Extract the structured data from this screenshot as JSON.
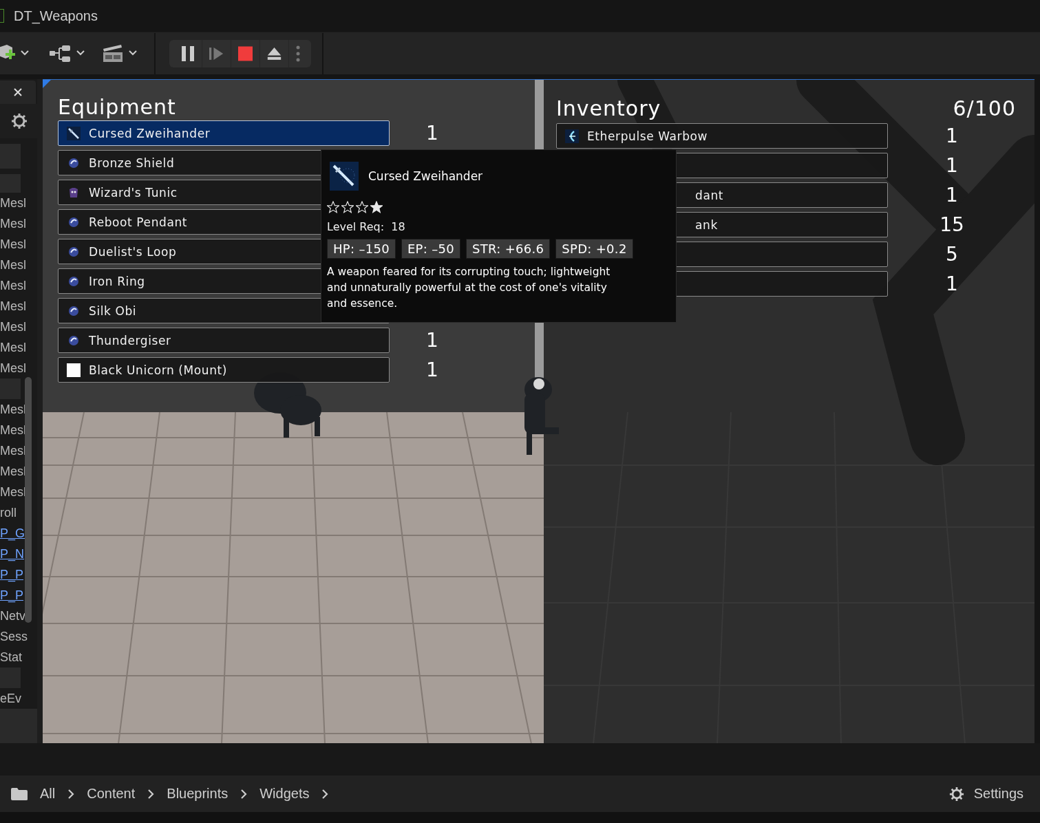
{
  "window": {
    "title": "DT_Weapons"
  },
  "sidebar": {
    "items": [
      {
        "kind": "text",
        "label": "Mesl"
      },
      {
        "kind": "text",
        "label": "Mesl"
      },
      {
        "kind": "text",
        "label": "Mesl"
      },
      {
        "kind": "text",
        "label": "Mesl"
      },
      {
        "kind": "text",
        "label": "Mesl"
      },
      {
        "kind": "text",
        "label": "Mesl"
      },
      {
        "kind": "text",
        "label": "Mesl"
      },
      {
        "kind": "text",
        "label": "Mesl"
      },
      {
        "kind": "text",
        "label": "Mesl"
      },
      {
        "kind": "spacer"
      },
      {
        "kind": "text",
        "label": "Mesl"
      },
      {
        "kind": "text",
        "label": "Mesl"
      },
      {
        "kind": "text",
        "label": "Mesl"
      },
      {
        "kind": "text",
        "label": "Mesl"
      },
      {
        "kind": "text",
        "label": "Mesl"
      },
      {
        "kind": "text",
        "label": "roll"
      },
      {
        "kind": "link",
        "label": "P_G"
      },
      {
        "kind": "link",
        "label": "P_N"
      },
      {
        "kind": "link",
        "label": "P_P"
      },
      {
        "kind": "link",
        "label": "P_P"
      },
      {
        "kind": "text",
        "label": "Netv"
      },
      {
        "kind": "text",
        "label": "Sess"
      },
      {
        "kind": "text",
        "label": "Stat"
      },
      {
        "kind": "spacer"
      },
      {
        "kind": "text",
        "label": "eEv"
      }
    ]
  },
  "equipment": {
    "title": "Equipment",
    "items": [
      {
        "name": "Cursed Zweihander",
        "quantity": "1",
        "kind": "weapon",
        "selected": true
      },
      {
        "name": "Bronze Shield",
        "kind": "gem",
        "selected": false
      },
      {
        "name": "Wizard's Tunic",
        "kind": "armor",
        "selected": false
      },
      {
        "name": "Reboot Pendant",
        "kind": "gem",
        "selected": false
      },
      {
        "name": "Duelist's Loop",
        "kind": "gem",
        "selected": false
      },
      {
        "name": "Iron Ring",
        "kind": "gem",
        "selected": false
      },
      {
        "name": "Silk Obi",
        "kind": "gem",
        "selected": false
      },
      {
        "name": "Thundergiser",
        "quantity": "1",
        "kind": "gem",
        "selected": false
      },
      {
        "name": "Black Unicorn (Mount)",
        "quantity": "1",
        "kind": "mount",
        "selected": false
      }
    ]
  },
  "inventory": {
    "title": "Inventory",
    "capacity": "6/100",
    "items": [
      {
        "name": "Etherpulse Warbow",
        "quantity": "1",
        "kind": "bow",
        "selected": false
      },
      {
        "quantity": "1",
        "kind": "covered",
        "selected": false
      },
      {
        "name_tail": "dant",
        "quantity": "1",
        "kind": "covered",
        "selected": false
      },
      {
        "name_tail": "ank",
        "quantity": "15",
        "kind": "covered",
        "selected": false
      },
      {
        "quantity": "5",
        "kind": "covered",
        "selected": false
      },
      {
        "quantity": "1",
        "kind": "covered",
        "selected": false
      }
    ]
  },
  "tooltip": {
    "name": "Cursed Zweihander",
    "stars": 1,
    "level_req": "Level Req:  18",
    "stats": [
      "HP: –150",
      "EP: –50",
      "STR: +66.6",
      "SPD: +0.2"
    ],
    "description": "A weapon feared for its corrupting touch; lightweight and unnaturally powerful at the cost of one's vitality and essence."
  },
  "breadcrumb": [
    "All",
    "Content",
    "Blueprints",
    "Widgets"
  ],
  "settings": "Settings"
}
